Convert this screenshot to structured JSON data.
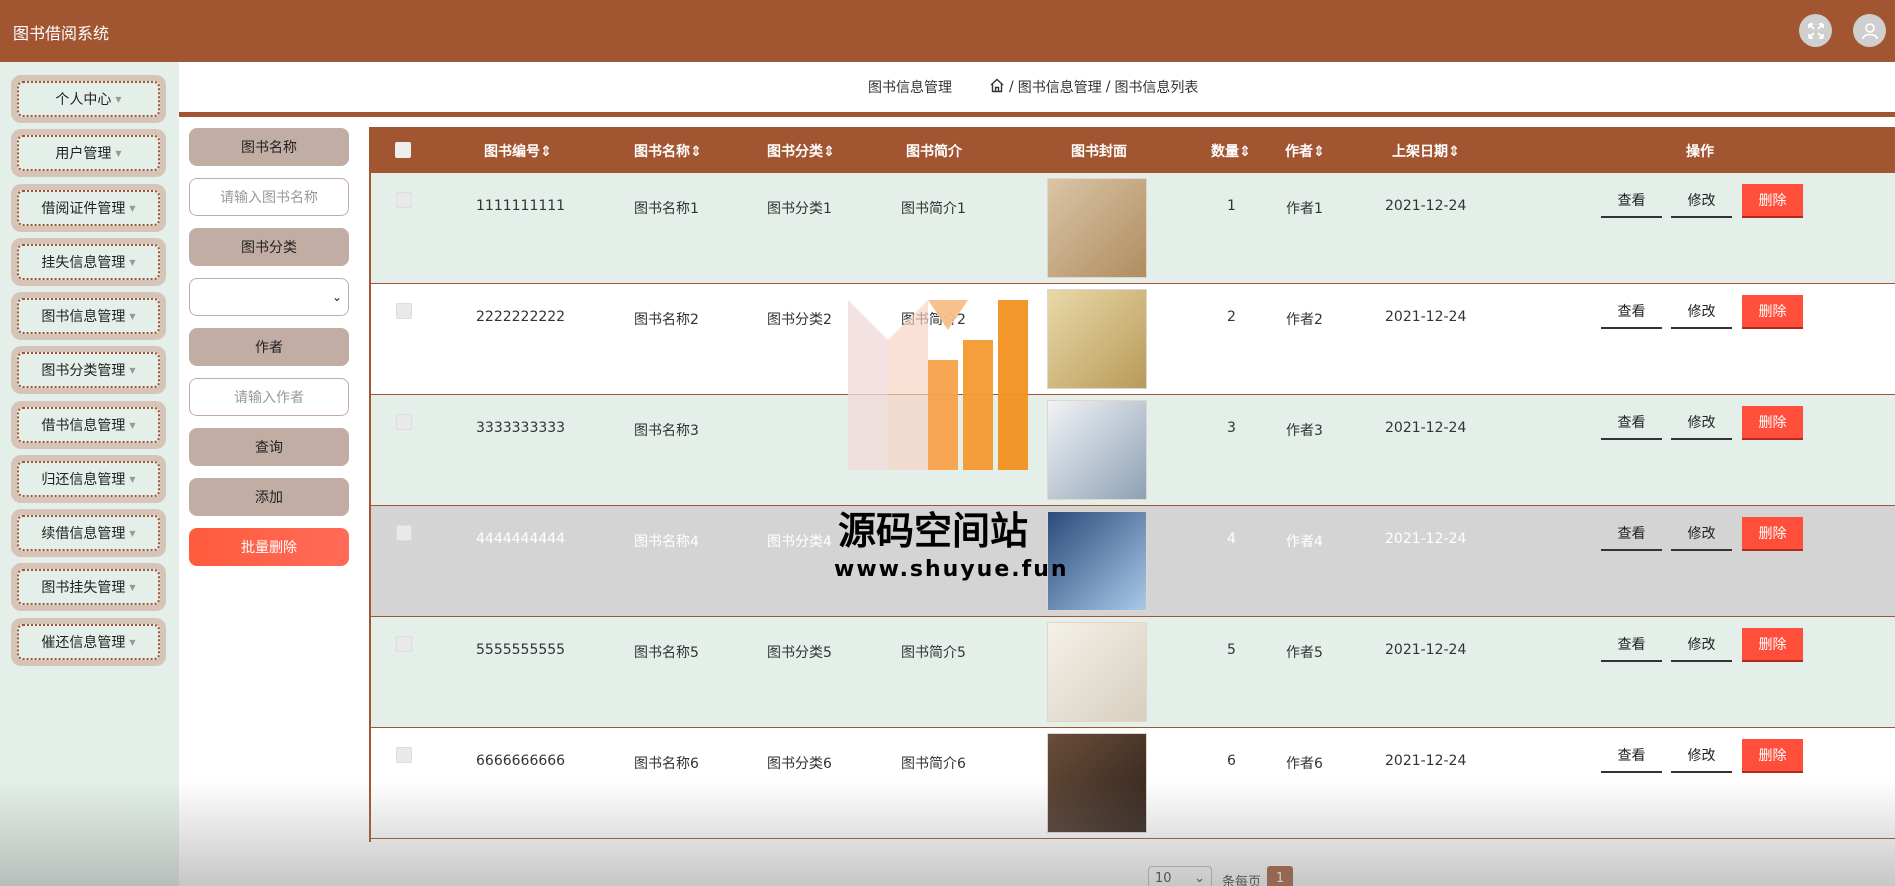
{
  "app": {
    "title": "图书借阅系统"
  },
  "header": {
    "fullscreen_icon": "fullscreen-icon",
    "user_icon": "user-icon"
  },
  "sidebar": {
    "items": [
      {
        "label": "个人中心"
      },
      {
        "label": "用户管理"
      },
      {
        "label": "借阅证件管理"
      },
      {
        "label": "挂失信息管理"
      },
      {
        "label": "图书信息管理"
      },
      {
        "label": "图书分类管理"
      },
      {
        "label": "借书信息管理"
      },
      {
        "label": "归还信息管理"
      },
      {
        "label": "续借信息管理"
      },
      {
        "label": "图书挂失管理"
      },
      {
        "label": "催还信息管理"
      }
    ]
  },
  "breadcrumb": {
    "title": "图书信息管理",
    "sep": "/",
    "level1": "图书信息管理",
    "level2": "图书信息列表"
  },
  "filter": {
    "book_name_label": "图书名称",
    "book_name_placeholder": "请输入图书名称",
    "category_label": "图书分类",
    "category_value": "",
    "author_label": "作者",
    "author_placeholder": "请输入作者",
    "search_button": "查询",
    "add_button": "添加",
    "batch_delete_button": "批量删除"
  },
  "table": {
    "columns": [
      "图书编号",
      "图书名称",
      "图书分类",
      "图书简介",
      "图书封面",
      "数量",
      "作者",
      "上架日期",
      "操作"
    ],
    "sortable_marker": "⇕",
    "rows": [
      {
        "id": "1111111111",
        "name": "图书名称1",
        "category": "图书分类1",
        "intro": "图书简介1",
        "qty": "1",
        "author": "作者1",
        "date": "2021-12-24"
      },
      {
        "id": "2222222222",
        "name": "图书名称2",
        "category": "图书分类2",
        "intro": "图书简介2",
        "qty": "2",
        "author": "作者2",
        "date": "2021-12-24"
      },
      {
        "id": "3333333333",
        "name": "图书名称3",
        "category": "",
        "intro": "",
        "qty": "3",
        "author": "作者3",
        "date": "2021-12-24"
      },
      {
        "id": "4444444444",
        "name": "图书名称4",
        "category": "图书分类4",
        "intro": "",
        "qty": "4",
        "author": "作者4",
        "date": "2021-12-24"
      },
      {
        "id": "5555555555",
        "name": "图书名称5",
        "category": "图书分类5",
        "intro": "图书简介5",
        "qty": "5",
        "author": "作者5",
        "date": "2021-12-24"
      },
      {
        "id": "6666666666",
        "name": "图书名称6",
        "category": "图书分类6",
        "intro": "图书简介6",
        "qty": "6",
        "author": "作者6",
        "date": "2021-12-24"
      }
    ],
    "actions": {
      "view": "查看",
      "edit": "修改",
      "delete": "删除"
    }
  },
  "pagination": {
    "page_size": "10",
    "page_size_label": "条每页",
    "current_page": "1"
  },
  "watermark": {
    "title": "源码空间站",
    "url": "www.shuyue.fun"
  },
  "colors": {
    "primary": "#a25531",
    "sidebar_bg": "#e4efe9",
    "delete": "#ff4f3b"
  }
}
